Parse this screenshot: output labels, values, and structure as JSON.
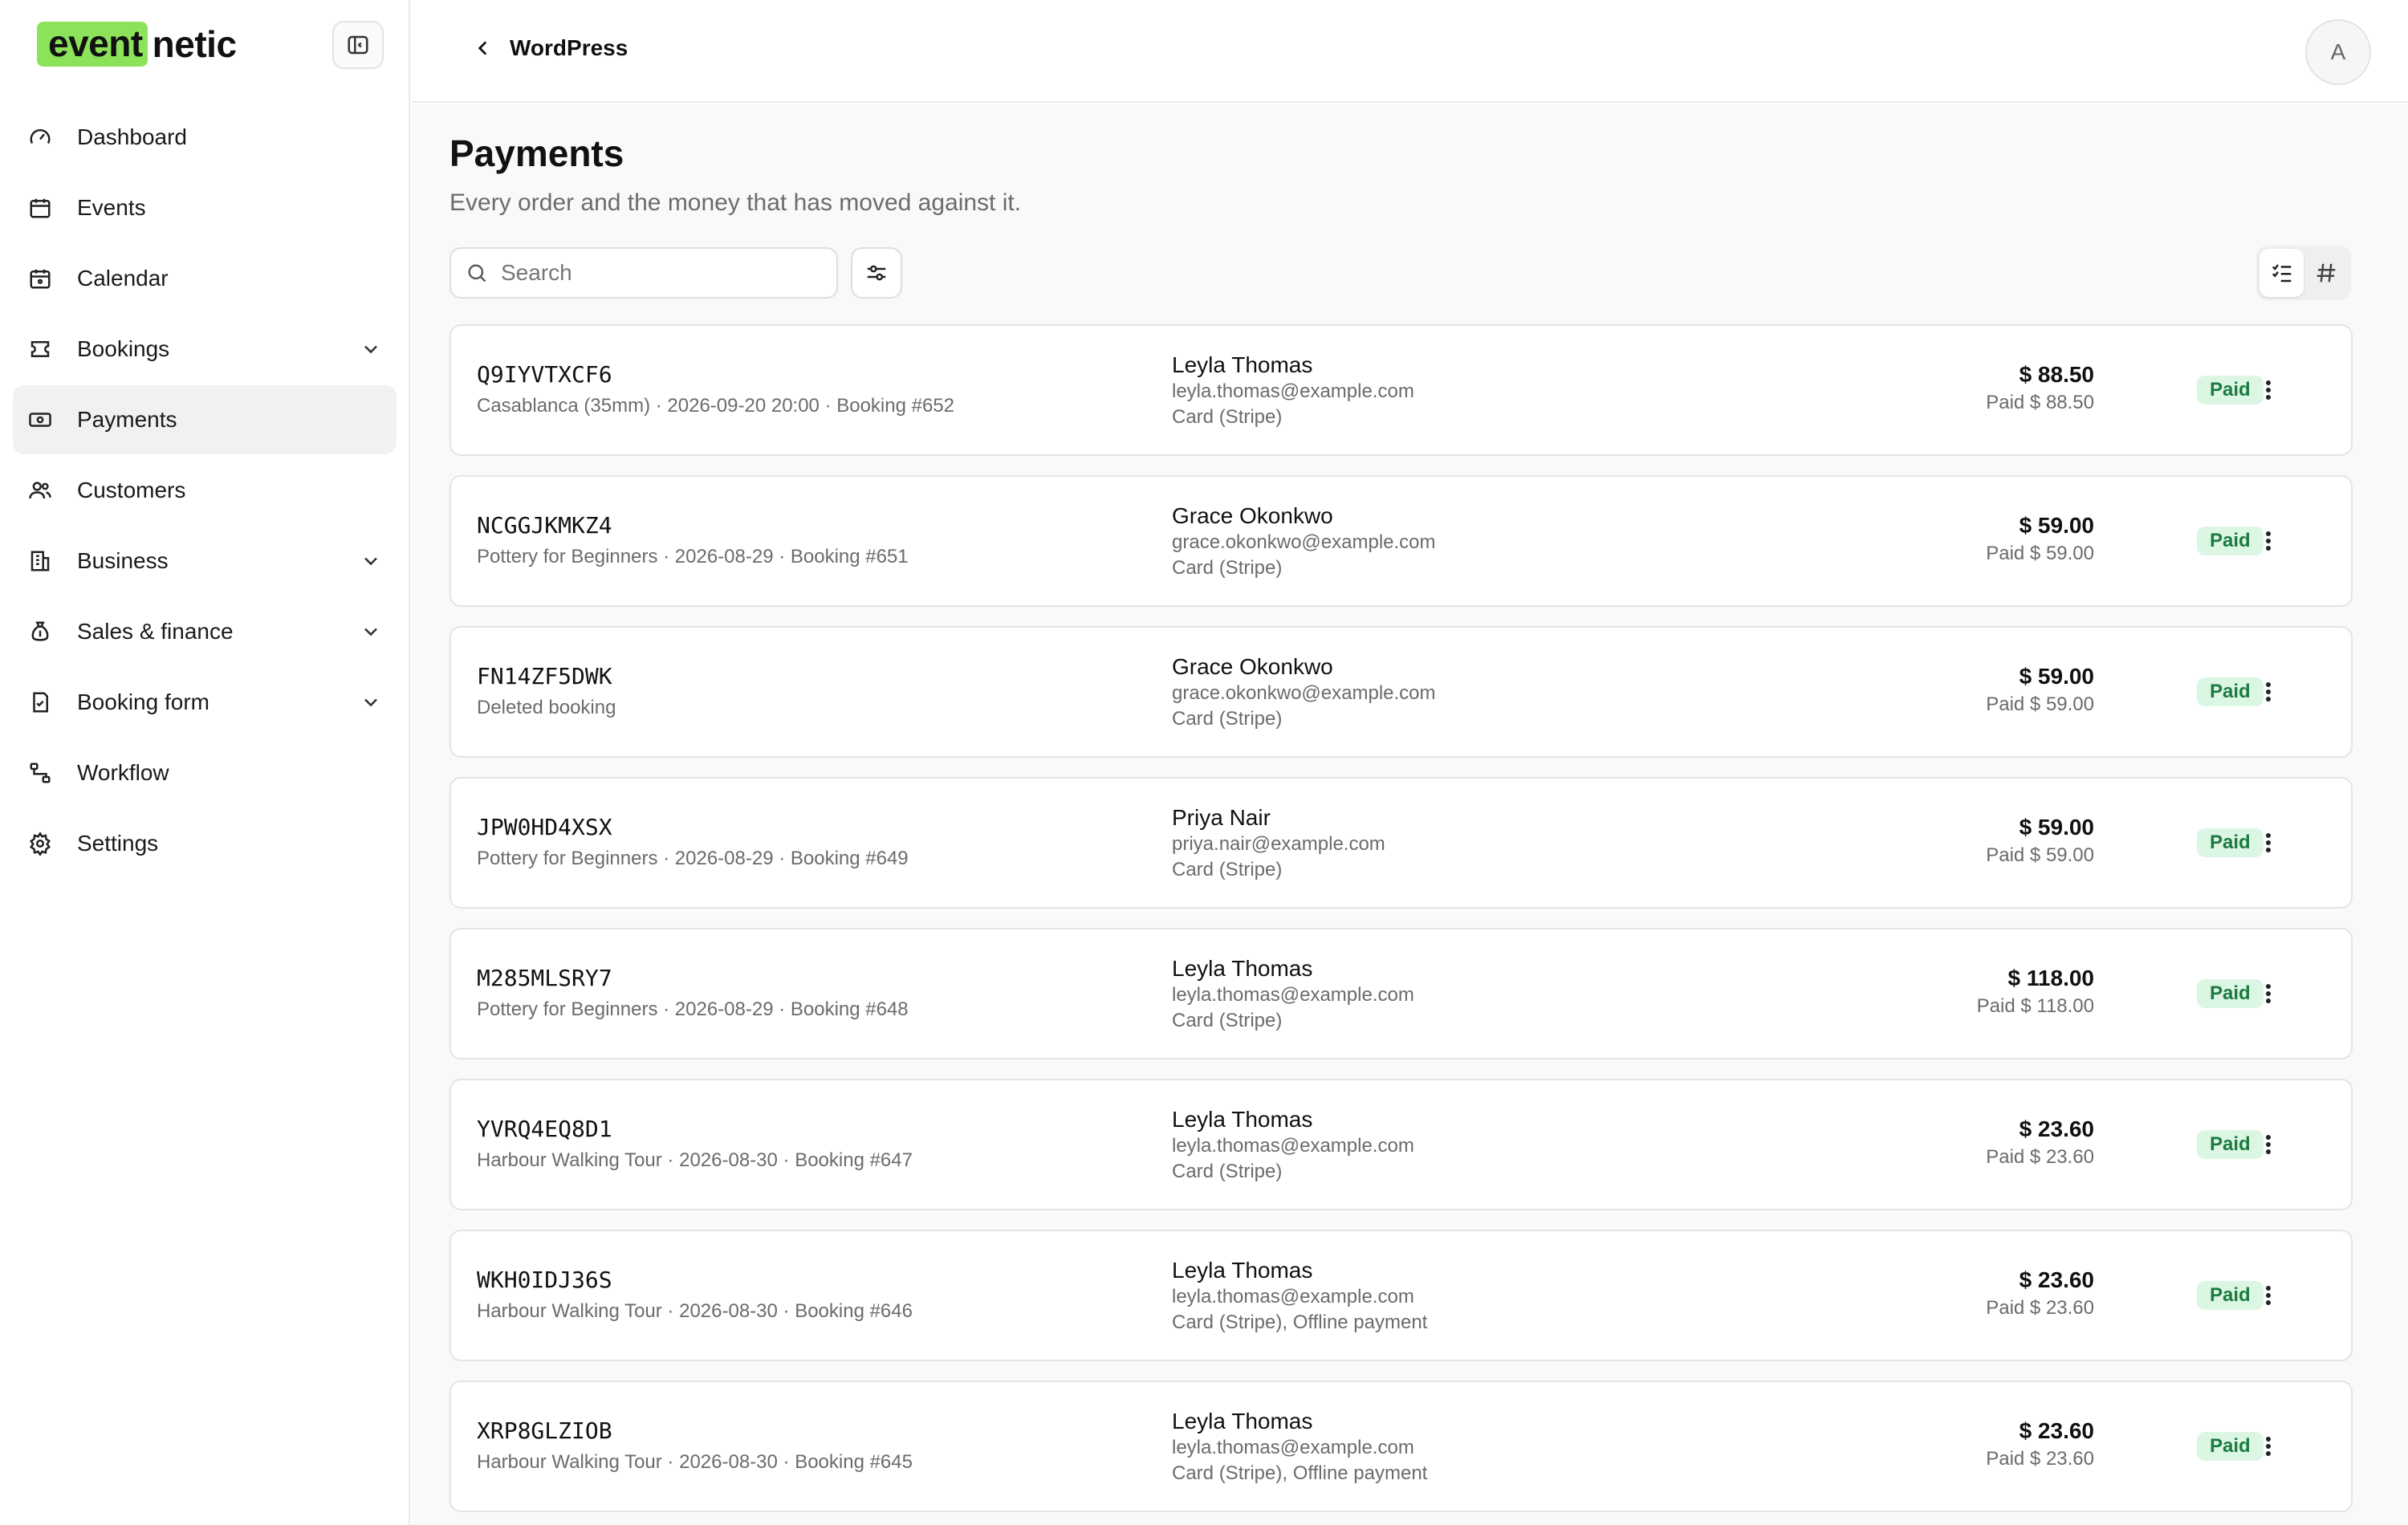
{
  "brand": {
    "logo_highlight": "event",
    "logo_rest": "netic",
    "accent": "#8ce35a"
  },
  "sidebar": {
    "items": [
      {
        "label": "Dashboard",
        "icon": "gauge-icon"
      },
      {
        "label": "Events",
        "icon": "calendar-icon"
      },
      {
        "label": "Calendar",
        "icon": "calendar-grid-icon"
      },
      {
        "label": "Bookings",
        "icon": "ticket-icon",
        "expandable": true
      },
      {
        "label": "Payments",
        "icon": "banknote-icon",
        "active": true
      },
      {
        "label": "Customers",
        "icon": "users-icon"
      },
      {
        "label": "Business",
        "icon": "building-icon",
        "expandable": true
      },
      {
        "label": "Sales & finance",
        "icon": "money-bag-icon",
        "expandable": true
      },
      {
        "label": "Booking form",
        "icon": "form-icon",
        "expandable": true
      },
      {
        "label": "Workflow",
        "icon": "workflow-icon"
      },
      {
        "label": "Settings",
        "icon": "gear-icon"
      }
    ]
  },
  "topbar": {
    "back_label": "WordPress",
    "avatar_initial": "A"
  },
  "page": {
    "title": "Payments",
    "subtitle": "Every order and the money that has moved against it.",
    "search_placeholder": "Search"
  },
  "status_colors": {
    "paid_bg": "#dcf6e4",
    "paid_text": "#1b7a3f"
  },
  "payments": [
    {
      "code": "Q9IYVTXCF6",
      "meta": "Casablanca (35mm) · 2026-09-20 20:00 · Booking #652",
      "name": "Leyla Thomas",
      "email": "leyla.thomas@example.com",
      "method": "Card (Stripe)",
      "total": "$ 88.50",
      "paid": "Paid $ 88.50",
      "status": "Paid"
    },
    {
      "code": "NCGGJKMKZ4",
      "meta": "Pottery for Beginners · 2026-08-29 · Booking #651",
      "name": "Grace Okonkwo",
      "email": "grace.okonkwo@example.com",
      "method": "Card (Stripe)",
      "total": "$ 59.00",
      "paid": "Paid $ 59.00",
      "status": "Paid"
    },
    {
      "code": "FN14ZF5DWK",
      "meta": "Deleted booking",
      "name": "Grace Okonkwo",
      "email": "grace.okonkwo@example.com",
      "method": "Card (Stripe)",
      "total": "$ 59.00",
      "paid": "Paid $ 59.00",
      "status": "Paid"
    },
    {
      "code": "JPW0HD4XSX",
      "meta": "Pottery for Beginners · 2026-08-29 · Booking #649",
      "name": "Priya Nair",
      "email": "priya.nair@example.com",
      "method": "Card (Stripe)",
      "total": "$ 59.00",
      "paid": "Paid $ 59.00",
      "status": "Paid"
    },
    {
      "code": "M285MLSRY7",
      "meta": "Pottery for Beginners · 2026-08-29 · Booking #648",
      "name": "Leyla Thomas",
      "email": "leyla.thomas@example.com",
      "method": "Card (Stripe)",
      "total": "$ 118.00",
      "paid": "Paid $ 118.00",
      "status": "Paid"
    },
    {
      "code": "YVRQ4EQ8D1",
      "meta": "Harbour Walking Tour · 2026-08-30 · Booking #647",
      "name": "Leyla Thomas",
      "email": "leyla.thomas@example.com",
      "method": "Card (Stripe)",
      "total": "$ 23.60",
      "paid": "Paid $ 23.60",
      "status": "Paid"
    },
    {
      "code": "WKH0IDJ36S",
      "meta": "Harbour Walking Tour · 2026-08-30 · Booking #646",
      "name": "Leyla Thomas",
      "email": "leyla.thomas@example.com",
      "method": "Card (Stripe), Offline payment",
      "total": "$ 23.60",
      "paid": "Paid $ 23.60",
      "status": "Paid"
    },
    {
      "code": "XRP8GLZIOB",
      "meta": "Harbour Walking Tour · 2026-08-30 · Booking #645",
      "name": "Leyla Thomas",
      "email": "leyla.thomas@example.com",
      "method": "Card (Stripe), Offline payment",
      "total": "$ 23.60",
      "paid": "Paid $ 23.60",
      "status": "Paid"
    }
  ]
}
